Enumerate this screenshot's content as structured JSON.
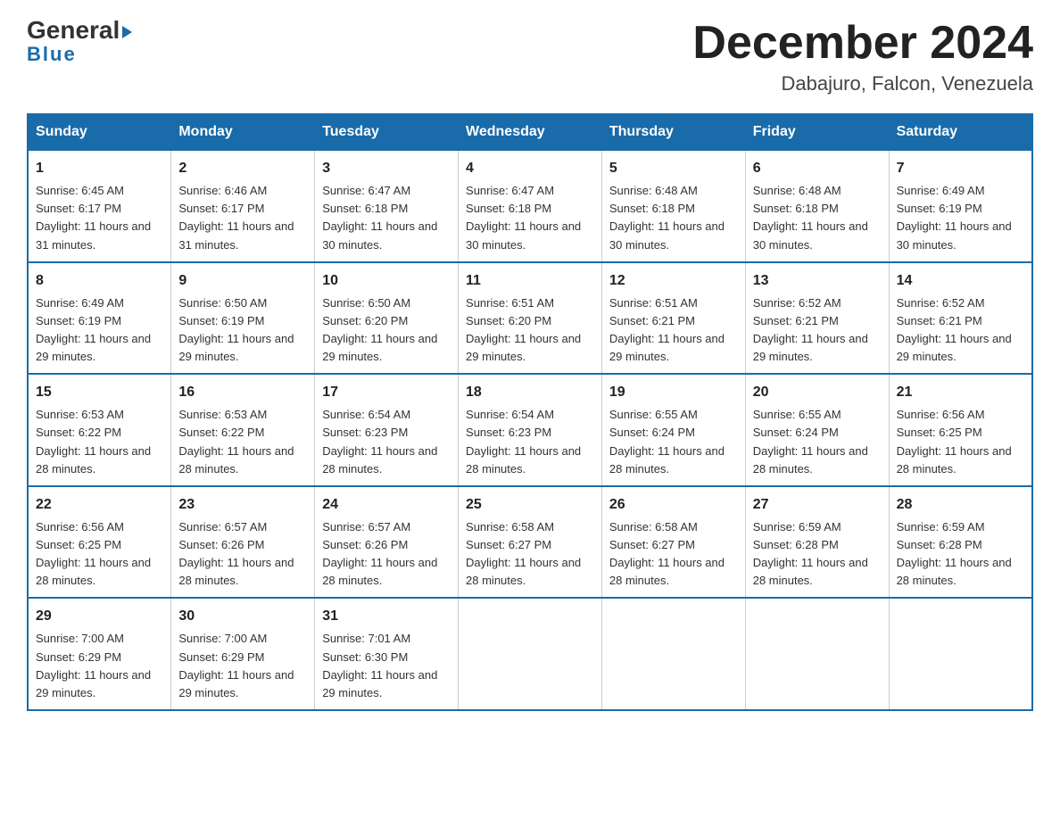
{
  "logo": {
    "general": "General",
    "blue": "Blue"
  },
  "title": "December 2024",
  "location": "Dabajuro, Falcon, Venezuela",
  "headers": [
    "Sunday",
    "Monday",
    "Tuesday",
    "Wednesday",
    "Thursday",
    "Friday",
    "Saturday"
  ],
  "weeks": [
    [
      {
        "day": "1",
        "sunrise": "6:45 AM",
        "sunset": "6:17 PM",
        "daylight": "11 hours and 31 minutes."
      },
      {
        "day": "2",
        "sunrise": "6:46 AM",
        "sunset": "6:17 PM",
        "daylight": "11 hours and 31 minutes."
      },
      {
        "day": "3",
        "sunrise": "6:47 AM",
        "sunset": "6:18 PM",
        "daylight": "11 hours and 30 minutes."
      },
      {
        "day": "4",
        "sunrise": "6:47 AM",
        "sunset": "6:18 PM",
        "daylight": "11 hours and 30 minutes."
      },
      {
        "day": "5",
        "sunrise": "6:48 AM",
        "sunset": "6:18 PM",
        "daylight": "11 hours and 30 minutes."
      },
      {
        "day": "6",
        "sunrise": "6:48 AM",
        "sunset": "6:18 PM",
        "daylight": "11 hours and 30 minutes."
      },
      {
        "day": "7",
        "sunrise": "6:49 AM",
        "sunset": "6:19 PM",
        "daylight": "11 hours and 30 minutes."
      }
    ],
    [
      {
        "day": "8",
        "sunrise": "6:49 AM",
        "sunset": "6:19 PM",
        "daylight": "11 hours and 29 minutes."
      },
      {
        "day": "9",
        "sunrise": "6:50 AM",
        "sunset": "6:19 PM",
        "daylight": "11 hours and 29 minutes."
      },
      {
        "day": "10",
        "sunrise": "6:50 AM",
        "sunset": "6:20 PM",
        "daylight": "11 hours and 29 minutes."
      },
      {
        "day": "11",
        "sunrise": "6:51 AM",
        "sunset": "6:20 PM",
        "daylight": "11 hours and 29 minutes."
      },
      {
        "day": "12",
        "sunrise": "6:51 AM",
        "sunset": "6:21 PM",
        "daylight": "11 hours and 29 minutes."
      },
      {
        "day": "13",
        "sunrise": "6:52 AM",
        "sunset": "6:21 PM",
        "daylight": "11 hours and 29 minutes."
      },
      {
        "day": "14",
        "sunrise": "6:52 AM",
        "sunset": "6:21 PM",
        "daylight": "11 hours and 29 minutes."
      }
    ],
    [
      {
        "day": "15",
        "sunrise": "6:53 AM",
        "sunset": "6:22 PM",
        "daylight": "11 hours and 28 minutes."
      },
      {
        "day": "16",
        "sunrise": "6:53 AM",
        "sunset": "6:22 PM",
        "daylight": "11 hours and 28 minutes."
      },
      {
        "day": "17",
        "sunrise": "6:54 AM",
        "sunset": "6:23 PM",
        "daylight": "11 hours and 28 minutes."
      },
      {
        "day": "18",
        "sunrise": "6:54 AM",
        "sunset": "6:23 PM",
        "daylight": "11 hours and 28 minutes."
      },
      {
        "day": "19",
        "sunrise": "6:55 AM",
        "sunset": "6:24 PM",
        "daylight": "11 hours and 28 minutes."
      },
      {
        "day": "20",
        "sunrise": "6:55 AM",
        "sunset": "6:24 PM",
        "daylight": "11 hours and 28 minutes."
      },
      {
        "day": "21",
        "sunrise": "6:56 AM",
        "sunset": "6:25 PM",
        "daylight": "11 hours and 28 minutes."
      }
    ],
    [
      {
        "day": "22",
        "sunrise": "6:56 AM",
        "sunset": "6:25 PM",
        "daylight": "11 hours and 28 minutes."
      },
      {
        "day": "23",
        "sunrise": "6:57 AM",
        "sunset": "6:26 PM",
        "daylight": "11 hours and 28 minutes."
      },
      {
        "day": "24",
        "sunrise": "6:57 AM",
        "sunset": "6:26 PM",
        "daylight": "11 hours and 28 minutes."
      },
      {
        "day": "25",
        "sunrise": "6:58 AM",
        "sunset": "6:27 PM",
        "daylight": "11 hours and 28 minutes."
      },
      {
        "day": "26",
        "sunrise": "6:58 AM",
        "sunset": "6:27 PM",
        "daylight": "11 hours and 28 minutes."
      },
      {
        "day": "27",
        "sunrise": "6:59 AM",
        "sunset": "6:28 PM",
        "daylight": "11 hours and 28 minutes."
      },
      {
        "day": "28",
        "sunrise": "6:59 AM",
        "sunset": "6:28 PM",
        "daylight": "11 hours and 28 minutes."
      }
    ],
    [
      {
        "day": "29",
        "sunrise": "7:00 AM",
        "sunset": "6:29 PM",
        "daylight": "11 hours and 29 minutes."
      },
      {
        "day": "30",
        "sunrise": "7:00 AM",
        "sunset": "6:29 PM",
        "daylight": "11 hours and 29 minutes."
      },
      {
        "day": "31",
        "sunrise": "7:01 AM",
        "sunset": "6:30 PM",
        "daylight": "11 hours and 29 minutes."
      },
      null,
      null,
      null,
      null
    ]
  ]
}
